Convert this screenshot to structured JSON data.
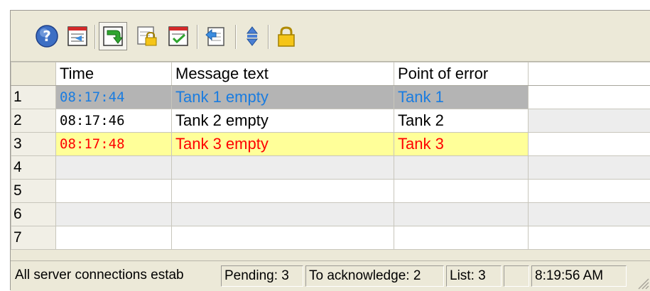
{
  "toolbar": {
    "buttons": [
      {
        "icon": "help-icon"
      },
      {
        "icon": "previous-page-icon"
      },
      {
        "icon": "autoscroll-icon",
        "pressed": true
      },
      {
        "icon": "lock-list-icon"
      },
      {
        "icon": "acknowledge-icon"
      },
      {
        "icon": "export-icon"
      },
      {
        "icon": "sort-icon"
      },
      {
        "icon": "lock-icon"
      }
    ]
  },
  "table": {
    "headers": [
      "Time",
      "Message text",
      "Point of error",
      ""
    ],
    "rows": [
      {
        "num": "1",
        "time": "08:17:44",
        "message": "Tank 1 empty",
        "point": "Tank 1",
        "state": "selected"
      },
      {
        "num": "2",
        "time": "08:17:46",
        "message": "Tank 2 empty",
        "point": "Tank 2",
        "state": "normal"
      },
      {
        "num": "3",
        "time": "08:17:48",
        "message": "Tank 3 empty",
        "point": "Tank 3",
        "state": "warning"
      },
      {
        "num": "4",
        "time": "",
        "message": "",
        "point": "",
        "state": "empty"
      },
      {
        "num": "5",
        "time": "",
        "message": "",
        "point": "",
        "state": "empty"
      },
      {
        "num": "6",
        "time": "",
        "message": "",
        "point": "",
        "state": "empty"
      },
      {
        "num": "7",
        "time": "",
        "message": "",
        "point": "",
        "state": "empty"
      }
    ]
  },
  "status": {
    "connection": "All  server connections estab",
    "pending": "Pending: 3",
    "acknowledge": "To acknowledge: 2",
    "list": "List: 3",
    "blank": "",
    "time": "8:19:56 AM"
  },
  "colors": {
    "selected_row_bg": "#b4b4b4",
    "selected_row_text": "#1a7ce0",
    "warning_row_bg": "#ffff99",
    "warning_row_text": "#ff0000"
  }
}
